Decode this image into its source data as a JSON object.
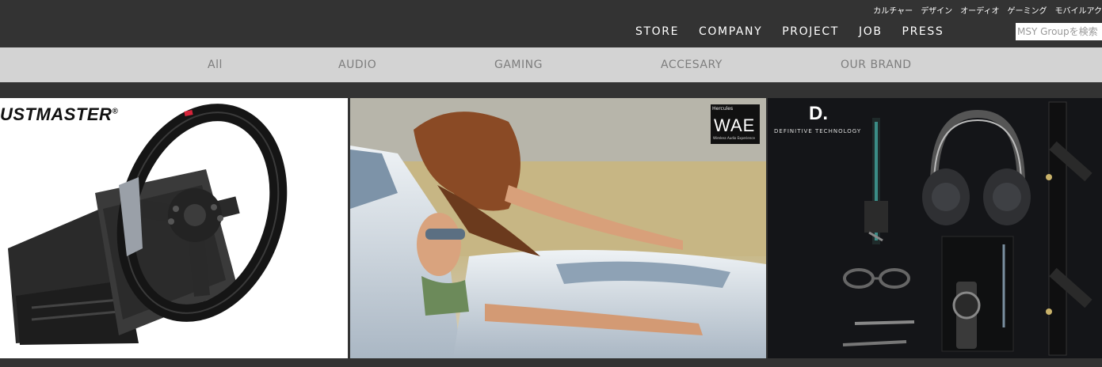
{
  "top_links": [
    "カルチャー",
    "デザイン",
    "オーディオ",
    "ゲーミング",
    "モバイルアク"
  ],
  "main_nav": [
    "STORE",
    "COMPANY",
    "PROJECT",
    "JOB",
    "PRESS"
  ],
  "search": {
    "placeholder": "MSY Groupを検索"
  },
  "filters": [
    "All",
    "AUDIO",
    "GAMING",
    "ACCESARY",
    "OUR BRAND"
  ],
  "tiles": {
    "wheel": {
      "brand": "USTMASTER",
      "registered": "®"
    },
    "convertible": {
      "logo_top": "Hercules",
      "logo_main": "WAE",
      "logo_sub": "Wireless Audio Experience"
    },
    "flatlay": {
      "logo_mark": "D.",
      "logo_name": "DEFINITIVE TECHNOLOGY"
    }
  },
  "colors": {
    "header_bg": "#333333",
    "filter_bg": "#d3d3d3",
    "filter_text": "#7d7d7d",
    "accent_red": "#d6243a"
  }
}
